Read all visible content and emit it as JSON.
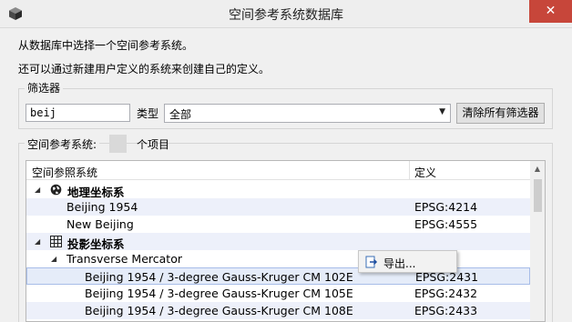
{
  "window": {
    "title": "空间参考系统数据库",
    "close_label": "✕"
  },
  "intro": {
    "line1": "从数据库中选择一个空间参考系统。",
    "line2": "还可以通过新建用户定义的系统来创建自己的定义。"
  },
  "filter": {
    "legend": "筛选器",
    "search_value": "beij",
    "type_label": "类型",
    "type_selected": "全部",
    "clear_button_label": "清除所有筛选器"
  },
  "srs": {
    "legend": "空间参考系统:",
    "count_label": "个项目",
    "columns": {
      "name": "空间参照系统",
      "definition": "定义"
    },
    "rows": [
      {
        "name": "地理坐标系",
        "definition": "",
        "type": "group",
        "icon": "globe-icon"
      },
      {
        "name": "Beijing 1954",
        "definition": "EPSG:4214",
        "type": "item"
      },
      {
        "name": "New Beijing",
        "definition": "EPSG:4555",
        "type": "item"
      },
      {
        "name": "投影坐标系",
        "definition": "",
        "type": "group",
        "icon": "grid-icon"
      },
      {
        "name": "Transverse Mercator",
        "definition": "",
        "type": "subgroup"
      },
      {
        "name": "Beijing 1954 / 3-degree Gauss-Kruger CM 102E",
        "definition": "EPSG:2431",
        "type": "item"
      },
      {
        "name": "Beijing 1954 / 3-degree Gauss-Kruger CM 105E",
        "definition": "EPSG:2432",
        "type": "item"
      },
      {
        "name": "Beijing 1954 / 3-degree Gauss-Kruger CM 108E",
        "definition": "EPSG:2433",
        "type": "item"
      }
    ]
  },
  "context_menu": {
    "items": [
      {
        "label": "导出...",
        "icon": "export-icon"
      }
    ]
  },
  "colors": {
    "close_button": "#c7463a",
    "row_alt": "#edf0fa",
    "row_selected": "#e5ecf9",
    "selection_border": "#a7bde8"
  }
}
